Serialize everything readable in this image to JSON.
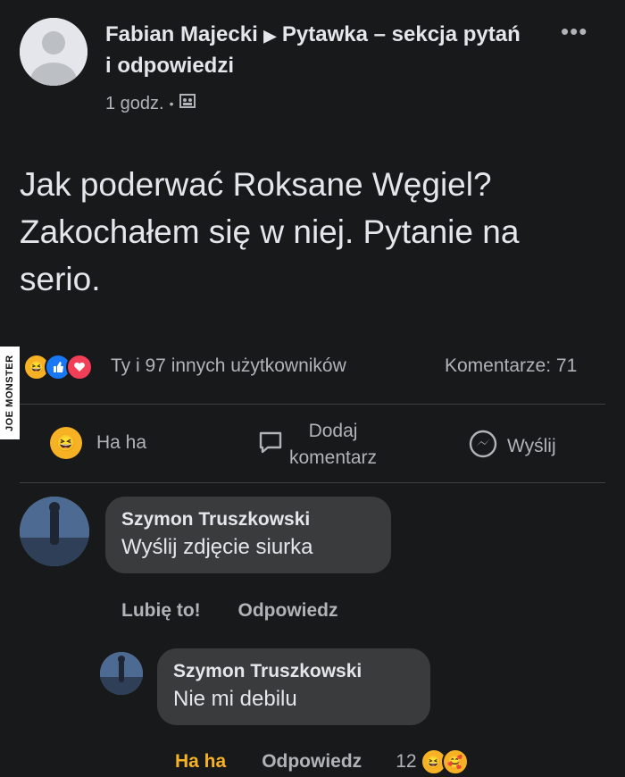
{
  "post": {
    "author": "Fabian Majecki",
    "arrow": "▶",
    "group": "Pytawka – sekcja pytań i odpowiedzi",
    "time": "1 godz.",
    "dot": "•",
    "more": "•••",
    "text": "Jak poderwać Roksane Węgiel? Zakochałem się w niej. Pytanie na serio."
  },
  "watermark": "JOE MONSTER",
  "stats": {
    "reactions_text": "Ty i 97 innych użytkowników",
    "comments_text": "Komentarze: 71"
  },
  "actions": {
    "haha": "Ha ha",
    "comment_line1": "Dodaj",
    "comment_line2": "komentarz",
    "send": "Wyślij"
  },
  "comments": [
    {
      "name": "Szymon Truszkowski",
      "text": "Wyślij zdjęcie siurka",
      "like": "Lubię to!",
      "reply": "Odpowiedz"
    },
    {
      "name": "Szymon Truszkowski",
      "text": "Nie mi debilu",
      "reaction_label": "Ha ha",
      "reply": "Odpowiedz",
      "reaction_count": "12"
    }
  ],
  "colors": {
    "background": "#18191a",
    "bubble": "#3a3b3c",
    "haha_active": "#f7b125",
    "secondary_text": "#b0b3b8"
  },
  "icons": {
    "more": "more-dots-icon",
    "privacy": "group-privacy-icon",
    "haha": "haha-reaction-icon",
    "like": "like-reaction-icon",
    "love": "love-reaction-icon",
    "comment": "comment-bubble-icon",
    "messenger": "messenger-icon",
    "care": "care-reaction-icon"
  }
}
